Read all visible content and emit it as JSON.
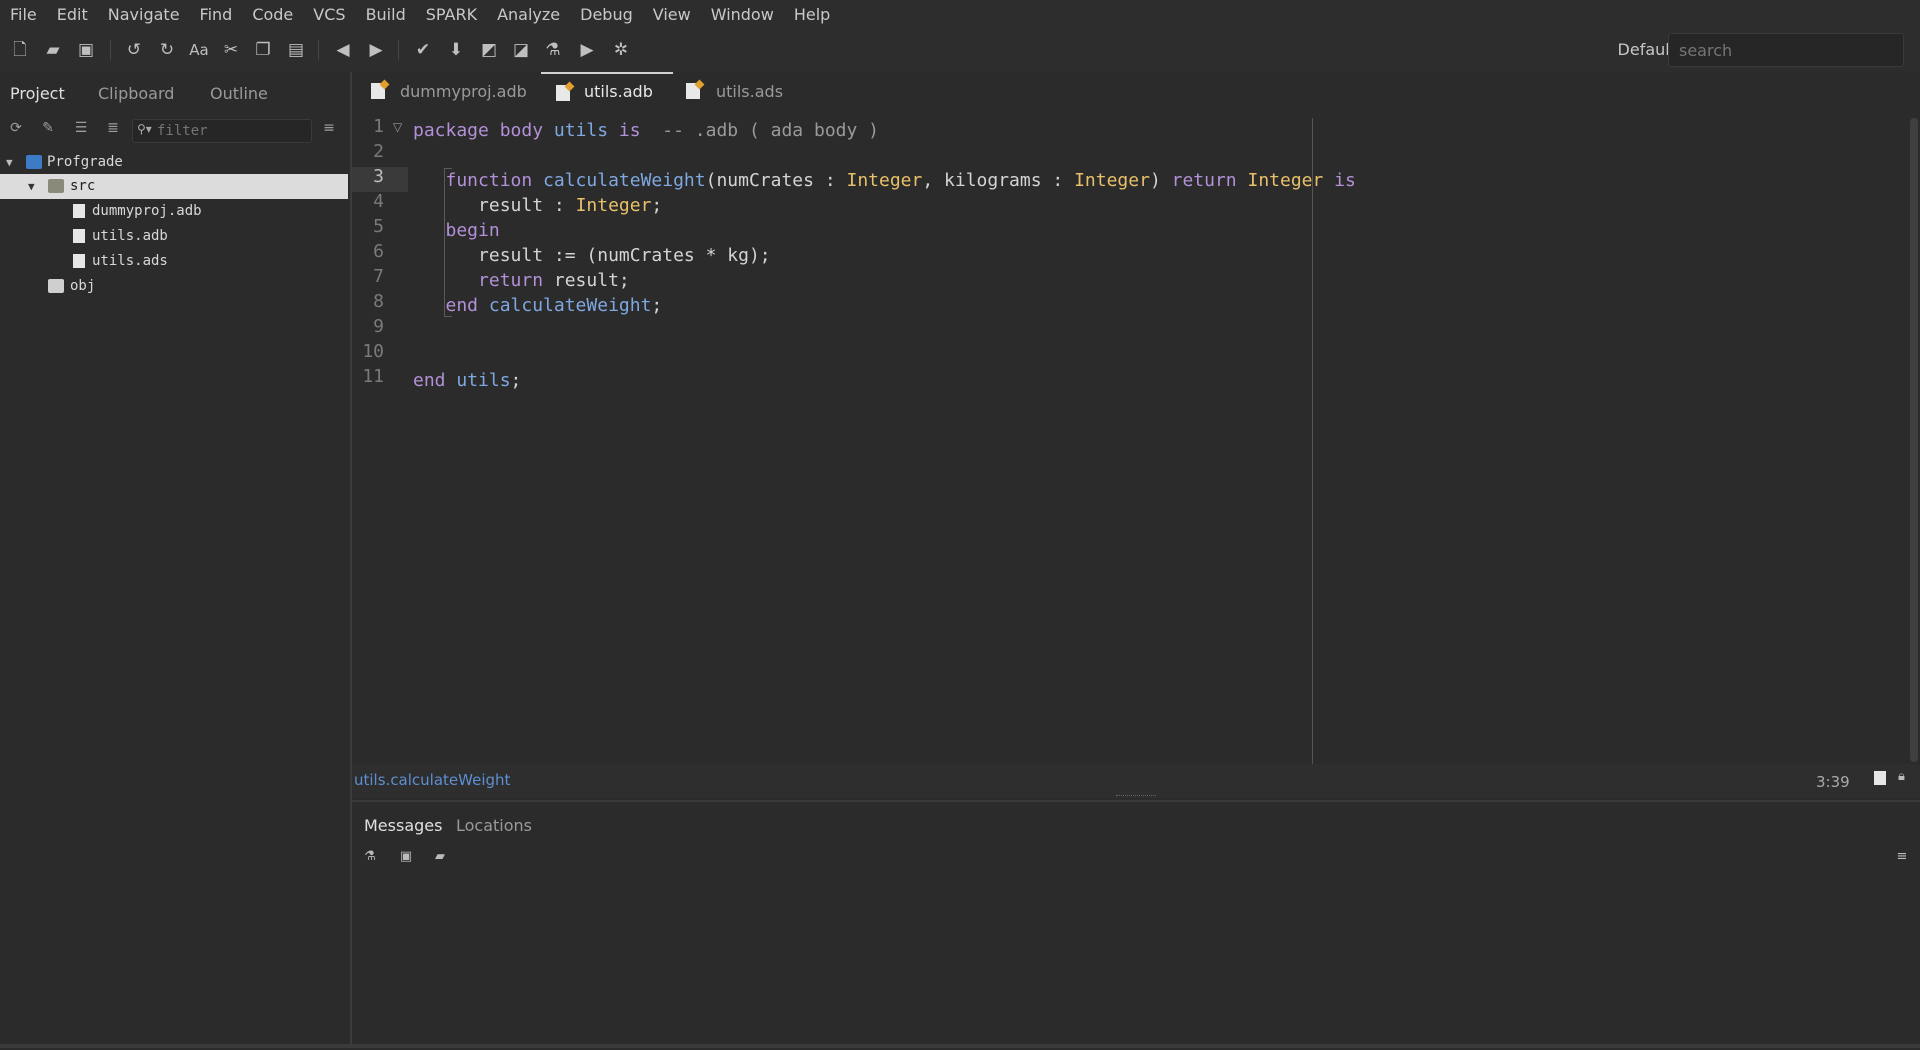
{
  "menu": [
    "File",
    "Edit",
    "Navigate",
    "Find",
    "Code",
    "VCS",
    "Build",
    "SPARK",
    "Analyze",
    "Debug",
    "View",
    "Window",
    "Help"
  ],
  "toolbar": {
    "perspective_label": "Default",
    "search_placeholder": "search",
    "icons": [
      "new-file-icon",
      "open-folder-icon",
      "save-icon",
      "undo-icon",
      "redo-icon",
      "font-icon",
      "cut-icon",
      "copy-icon",
      "paste-icon",
      "back-arrow-icon",
      "forward-arrow-icon",
      "check-icon",
      "download-icon",
      "build-icon",
      "build-all-icon",
      "flask-icon",
      "run-icon",
      "debug-icon"
    ]
  },
  "left_panel": {
    "tabs": [
      "Project",
      "Clipboard",
      "Outline"
    ],
    "filter_placeholder": "filter",
    "tree": [
      {
        "label": "Profgrade",
        "type": "project",
        "expanded": true
      },
      {
        "label": "src",
        "type": "folder",
        "expanded": true,
        "selected": true
      },
      {
        "label": "dummyproj.adb",
        "type": "file"
      },
      {
        "label": "utils.adb",
        "type": "file"
      },
      {
        "label": "utils.ads",
        "type": "file"
      },
      {
        "label": "obj",
        "type": "folder-special"
      }
    ]
  },
  "editor": {
    "tabs": [
      {
        "label": "dummyproj.adb",
        "active": false
      },
      {
        "label": "utils.adb",
        "active": true
      },
      {
        "label": "utils.ads",
        "active": false
      }
    ],
    "line_numbers": [
      "1",
      "2",
      "3",
      "4",
      "5",
      "6",
      "7",
      "8",
      "9",
      "10",
      "11"
    ],
    "current_line": 3,
    "code": {
      "l1_a": "package body ",
      "l1_b": "utils",
      "l1_c": " is",
      "l1_d": "  -- .adb ( ada body )",
      "l3_a": "   function ",
      "l3_b": "calculateWeight",
      "l3_c": "(numCrates : ",
      "l3_d": "Integer",
      "l3_e": ", kilograms : ",
      "l3_f": "Integer",
      "l3_g": ") ",
      "l3_h": "return ",
      "l3_i": "Integer",
      "l3_j": " is",
      "l4_a": "      result : ",
      "l4_b": "Integer",
      "l4_c": ";",
      "l5_a": "   begin",
      "l6_a": "      result := (numCrates * kg);",
      "l7_a": "      return",
      "l7_b": " result;",
      "l8_a": "   end ",
      "l8_b": "calculateWeight",
      "l8_c": ";",
      "l11_a": "end ",
      "l11_b": "utils",
      "l11_c": ";"
    },
    "breadcrumb_pkg": "utils",
    "breadcrumb_fn": ".calculateWeight",
    "cursor_position": "3:39"
  },
  "messages_panel": {
    "tabs": [
      "Messages",
      "Locations"
    ]
  },
  "colors": {
    "keyword": "#b390d8",
    "identifier": "#7fa8e0",
    "type": "#e8c06a",
    "breadcrumb": "#5d8fd1"
  }
}
